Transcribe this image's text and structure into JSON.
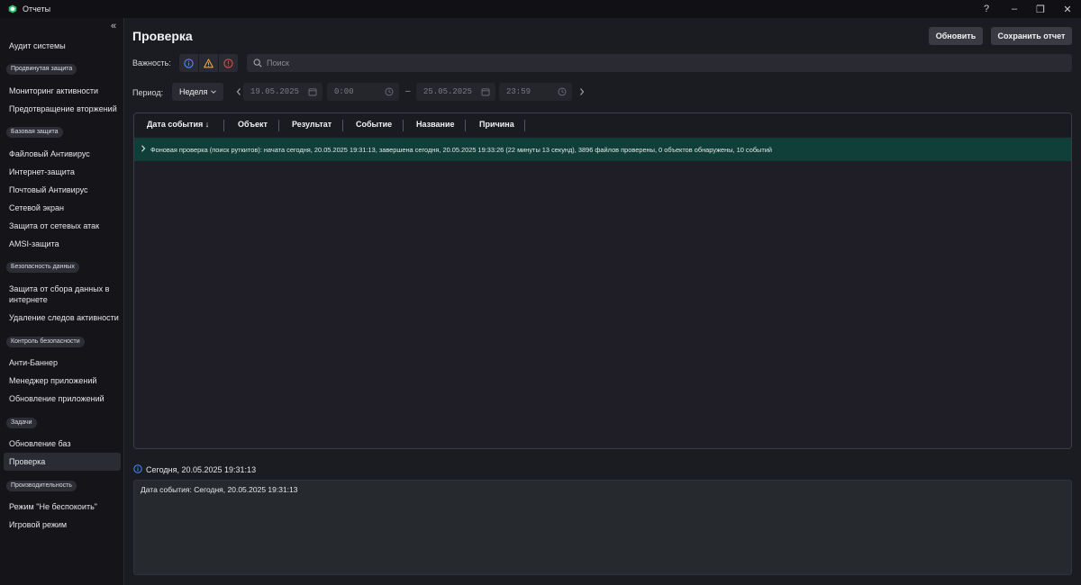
{
  "window": {
    "title": "Отчеты",
    "help_label": "?",
    "minimize_label": "–",
    "maximize_label": "❐",
    "close_label": "✕",
    "brand_color": "#2fbf71"
  },
  "sidebar": {
    "collapse_label": "«",
    "top_item": "Аудит системы",
    "groups": [
      {
        "badge": "Продвинутая защита",
        "items": [
          "Мониторинг активности",
          "Предотвращение вторжений"
        ]
      },
      {
        "badge": "Базовая защита",
        "items": [
          "Файловый Антивирус",
          "Интернет-защита",
          "Почтовый Антивирус",
          "Сетевой экран",
          "Защита от сетевых атак",
          "AMSI-защита"
        ]
      },
      {
        "badge": "Безопасность данных",
        "items": [
          "Защита от сбора данных в интернете",
          "Удаление следов активности"
        ]
      },
      {
        "badge": "Контроль безопасности",
        "items": [
          "Анти-Баннер",
          "Менеджер приложений",
          "Обновление приложений"
        ]
      },
      {
        "badge": "Задачи",
        "items": [
          "Обновление баз",
          "Проверка"
        ]
      },
      {
        "badge": "Производительность",
        "items": [
          "Режим \"Не беспокоить\"",
          "Игровой режим"
        ]
      }
    ],
    "active_item": "Проверка"
  },
  "header": {
    "title": "Проверка",
    "refresh_label": "Обновить",
    "save_report_label": "Сохранить отчет"
  },
  "filters": {
    "severity_label": "Важность:",
    "severity_icons": [
      "info-icon",
      "warning-icon",
      "critical-icon"
    ],
    "severity_colors": {
      "info": "#4a8dff",
      "warning": "#e8a33c",
      "critical": "#e24b4b"
    },
    "search_placeholder": "Поиск",
    "period_label": "Период:",
    "period_value": "Неделя",
    "date_from": "19.05.2025",
    "time_from": "0:00",
    "range_separator": "–",
    "date_to": "25.05.2025",
    "time_to": "23:59"
  },
  "table": {
    "columns": [
      "Дата события ↓",
      "Объект",
      "Результат",
      "Событие",
      "Название",
      "Причина"
    ],
    "rows": [
      {
        "text": "Фоновая проверка (поиск руткитов): начата сегодня, 20.05.2025 19:31:13, завершена сегодня, 20.05.2025 19:33:26 (22 минуты 13 секунд), 3896 файлов проверены, 0 объектов обнаружены, 10 событий"
      }
    ],
    "selected_row_color": "#0f3f38"
  },
  "detail": {
    "title": "Сегодня, 20.05.2025 19:31:13",
    "text": "Дата события: Сегодня, 20.05.2025 19:31:13"
  }
}
